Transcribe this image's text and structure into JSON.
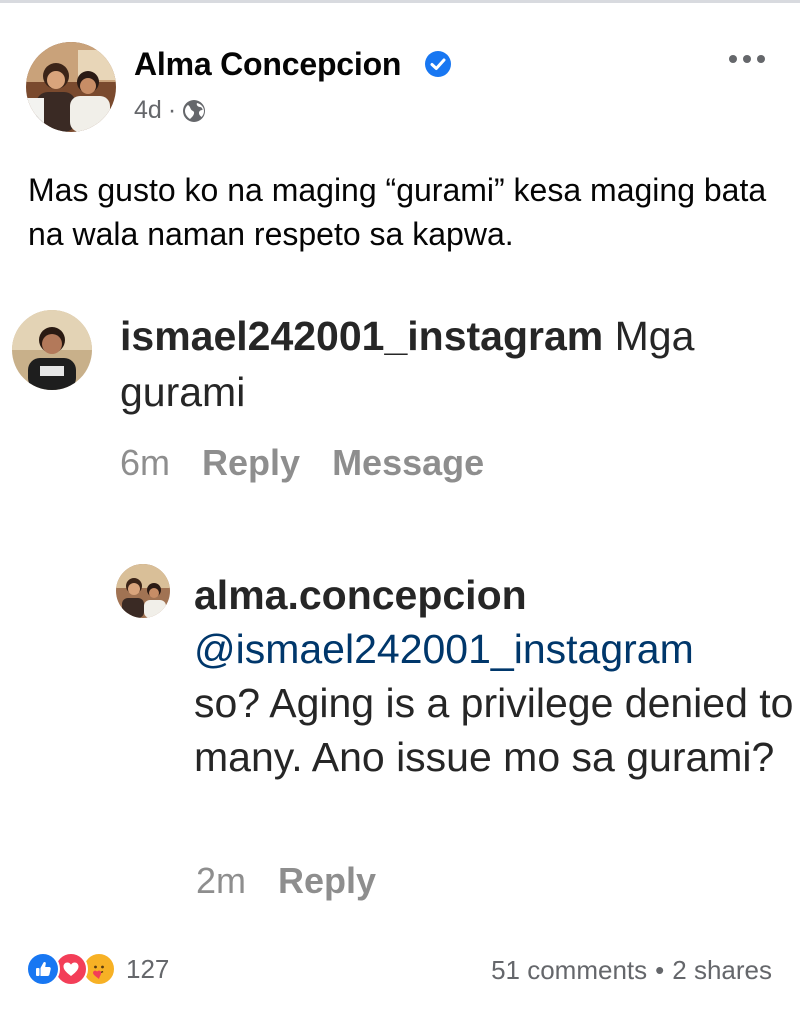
{
  "post": {
    "author": "Alma Concepcion",
    "time": "4d",
    "separator": "·",
    "text": "Mas gusto ko na maging “gurami” kesa maging bata na wala naman respeto sa kapwa."
  },
  "comments": [
    {
      "username": "ismael242001_instagram",
      "text": "Mga gurami",
      "time": "6m",
      "reply_label": "Reply",
      "message_label": "Message"
    },
    {
      "username": "alma.concepcion",
      "mention": "@ismael242001_instagram",
      "text": "so? Aging is a privilege denied to many. Ano issue mo sa gurami?",
      "time": "2m",
      "reply_label": "Reply"
    }
  ],
  "footer": {
    "reaction_count": "127",
    "comments": "51 comments",
    "separator": "•",
    "shares": "2 shares"
  },
  "icons": {
    "verified": "verified-badge-icon",
    "privacy": "globe-icon",
    "more": "more-options-icon",
    "reactions": [
      "like-icon",
      "love-icon",
      "care-icon"
    ]
  },
  "colors": {
    "facebook_blue": "#1877f2",
    "love_red": "#f33e58",
    "care_yellow": "#f7b125",
    "secondary_text": "#65676b",
    "instagram_mention": "#00376b",
    "instagram_meta": "#8e8e8e"
  }
}
